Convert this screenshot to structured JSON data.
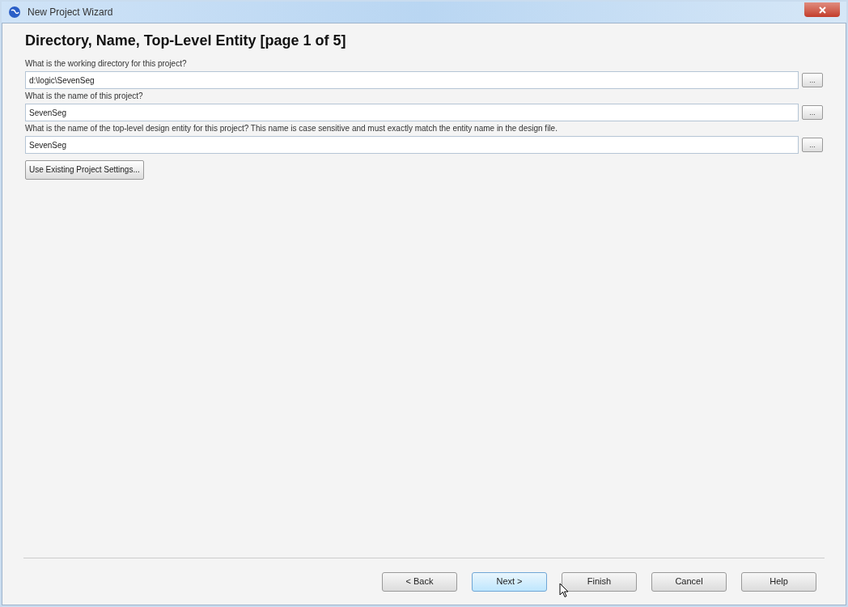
{
  "window": {
    "title": "New Project Wizard"
  },
  "heading": "Directory, Name, Top-Level Entity [page 1 of 5]",
  "fields": [
    {
      "label": "What is the working directory for this project?",
      "value": "d:\\logic\\SevenSeg",
      "browse": "..."
    },
    {
      "label": "What is the name of this project?",
      "value": "SevenSeg",
      "browse": "..."
    },
    {
      "label": "What is the name of the top-level design entity for this project? This name is case sensitive and must exactly match the entity name in the design file.",
      "value": "SevenSeg",
      "browse": "..."
    }
  ],
  "settings_button": "Use Existing Project Settings...",
  "buttons": [
    {
      "label": "< Back",
      "highlighted": false
    },
    {
      "label": "Next >",
      "highlighted": true
    },
    {
      "label": "Finish",
      "highlighted": false
    },
    {
      "label": "Cancel",
      "highlighted": false
    },
    {
      "label": "Help",
      "highlighted": false
    }
  ]
}
